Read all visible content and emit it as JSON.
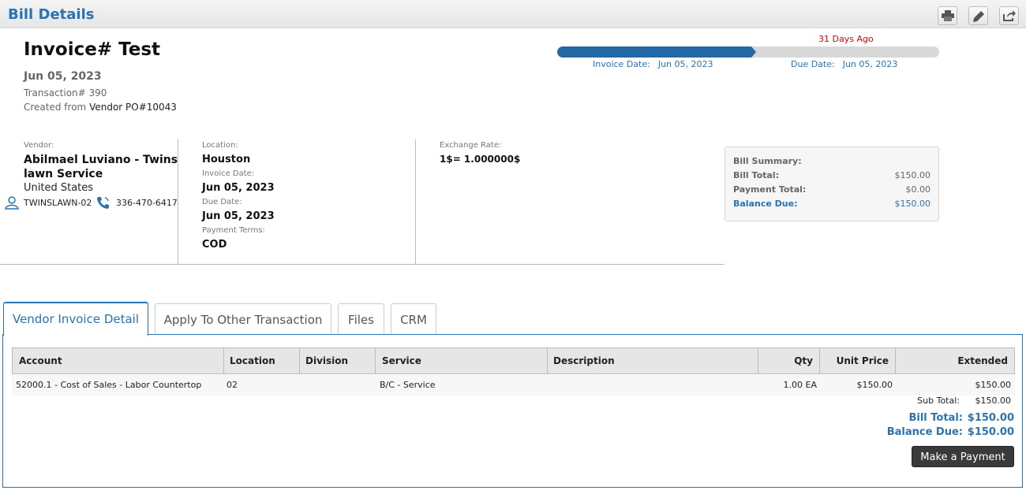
{
  "header": {
    "title": "Bill Details",
    "actions": [
      "print-icon",
      "edit-icon",
      "share-icon"
    ]
  },
  "invoice": {
    "title": "Invoice# Test",
    "date": "Jun 05, 2023",
    "transaction_label": "Transaction#",
    "transaction_number": "390",
    "created_label": "Created from",
    "created_value": "Vendor PO#10043"
  },
  "timeline": {
    "days_ago": "31 Days Ago",
    "progress_fraction": 0.52,
    "invoice_date_label": "Invoice Date:",
    "invoice_date_value": "Jun 05, 2023",
    "due_date_label": "Due Date:",
    "due_date_value": "Jun 05, 2023"
  },
  "vendor": {
    "label": "Vendor:",
    "name_line1": "Abilmael Luviano - Twins",
    "name_line2": "lawn Service",
    "country": "United States",
    "code": "TWINSLAWN-02",
    "phone": "336-470-6417"
  },
  "details": {
    "location_label": "Location:",
    "location_value": "Houston",
    "invoice_date_label": "Invoice Date:",
    "invoice_date_value": "Jun 05, 2023",
    "due_date_label": "Due Date:",
    "due_date_value": "Jun 05, 2023",
    "payment_terms_label": "Payment Terms:",
    "payment_terms_value": "COD"
  },
  "exchange": {
    "label": "Exchange Rate:",
    "value": "1$= 1.000000$"
  },
  "summary": {
    "title": "Bill Summary:",
    "bill_total_label": "Bill Total:",
    "bill_total_value": "$150.00",
    "payment_total_label": "Payment Total:",
    "payment_total_value": "$0.00",
    "balance_due_label": "Balance Due:",
    "balance_due_value": "$150.00"
  },
  "tabs": [
    "Vendor Invoice Detail",
    "Apply To Other Transaction",
    "Files",
    "CRM"
  ],
  "table": {
    "columns": [
      "Account",
      "Location",
      "Division",
      "Service",
      "Description",
      "Qty",
      "Unit Price",
      "Extended"
    ],
    "rows": [
      [
        "52000.1 - Cost of Sales - Labor Countertop",
        "02",
        "",
        "B/C - Service",
        "",
        "1.00 EA",
        "$150.00",
        "$150.00"
      ]
    ]
  },
  "totals": {
    "sub_total_label": "Sub Total:",
    "sub_total_value": "$150.00",
    "bill_total_label": "Bill Total:",
    "bill_total_value": "$150.00",
    "balance_due_label": "Balance Due:",
    "balance_due_value": "$150.00"
  },
  "make_payment_label": "Make a Payment",
  "colors": {
    "accent": "#2a73b0",
    "progress": "#2367a5",
    "alert": "#e00000",
    "button": "#3a3a3a"
  }
}
